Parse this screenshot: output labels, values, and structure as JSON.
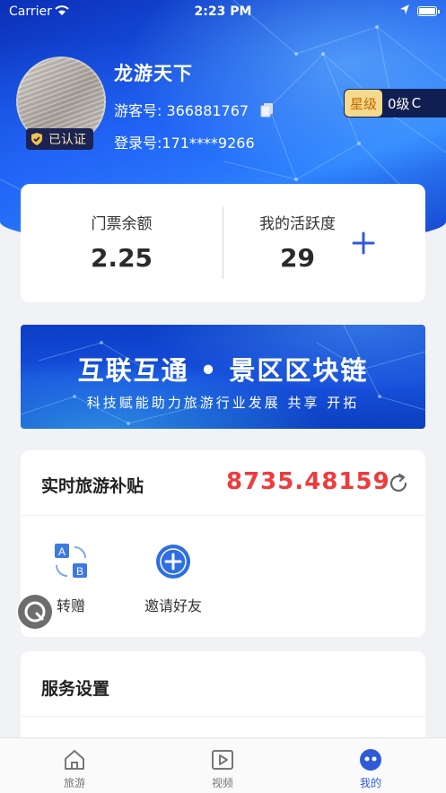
{
  "status_bar": {
    "carrier": "Carrier",
    "time": "2:23 PM"
  },
  "profile": {
    "name": "龙游天下",
    "visitor_id_label": "游客号: 366881767",
    "login_label": "登录号:171****9266",
    "verified_label": "已认证",
    "star_tag": "星级",
    "level": "0级",
    "level_icon": "C"
  },
  "stats": {
    "ticket_label": "门票余额",
    "ticket_value": "2.25",
    "activity_label": "我的活跃度",
    "activity_value": "29"
  },
  "banner": {
    "title": "互联互通 • 景区区块链",
    "subtitle": "科技赋能助力旅游行业发展  共享  开拓"
  },
  "subsidy": {
    "label": "实时旅游补贴",
    "value": "8735.48159",
    "actions": [
      {
        "label": "转赠",
        "icon": "transfer-ab-icon"
      },
      {
        "label": "邀请好友",
        "icon": "invite-plus-icon"
      }
    ]
  },
  "service": {
    "label": "服务设置"
  },
  "tabs": [
    {
      "label": "旅游",
      "icon": "home-icon",
      "active": false
    },
    {
      "label": "视频",
      "icon": "video-icon",
      "active": false
    },
    {
      "label": "我的",
      "icon": "profile-face-icon",
      "active": true
    }
  ],
  "colors": {
    "accent": "#2f5bd8",
    "subsidy_value": "#ee3b3b",
    "star_tag_bg": "#f5d98c"
  }
}
